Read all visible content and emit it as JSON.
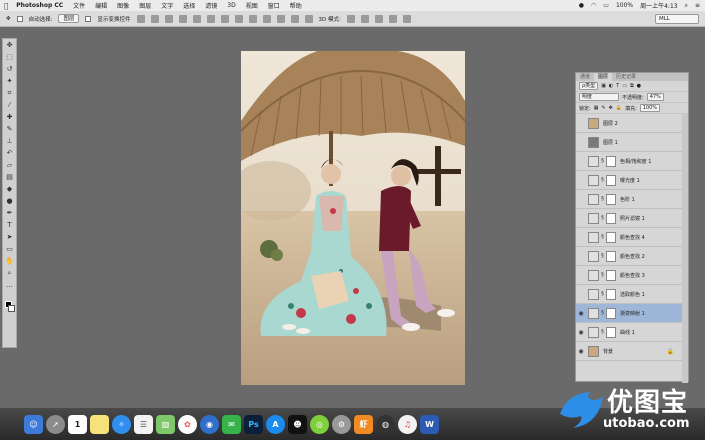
{
  "menubar": {
    "app_name": "Photoshop CC",
    "items": [
      "文件",
      "编辑",
      "图像",
      "图层",
      "文字",
      "选择",
      "滤镜",
      "3D",
      "视图",
      "窗口",
      "帮助"
    ],
    "battery": "100%",
    "clock": "周一上午4:13"
  },
  "options_bar": {
    "auto_select_label": "自动选择:",
    "auto_select_value": "图层",
    "show_transform_label": "显示变换控件",
    "mode_3d_label": "3D 模式:",
    "preset_value": "MLL"
  },
  "layers_panel": {
    "tabs": [
      "通道",
      "图层",
      "历史记录"
    ],
    "active_tab": "图层",
    "filter_label": "ρ类型",
    "blend_mode": "明度",
    "opacity_label": "不透明度:",
    "opacity_value": "47%",
    "lock_label": "锁定:",
    "fill_label": "填充:",
    "fill_value": "100%",
    "layers": [
      {
        "name": "图层 2",
        "visible": false,
        "has_mask": false
      },
      {
        "name": "图层 1",
        "visible": false,
        "has_mask": false
      },
      {
        "name": "色相/饱和度 1",
        "visible": false,
        "has_mask": true
      },
      {
        "name": "曝光度 1",
        "visible": false,
        "has_mask": true
      },
      {
        "name": "色阶 1",
        "visible": false,
        "has_mask": true
      },
      {
        "name": "照片滤镜 1",
        "visible": false,
        "has_mask": true
      },
      {
        "name": "颜色查找 4",
        "visible": false,
        "has_mask": true
      },
      {
        "name": "颜色查找 2",
        "visible": false,
        "has_mask": true
      },
      {
        "name": "颜色查找 3",
        "visible": false,
        "has_mask": true
      },
      {
        "name": "选取颜色 1",
        "visible": false,
        "has_mask": true
      },
      {
        "name": "渐变映射 1",
        "visible": true,
        "has_mask": true,
        "selected": true
      },
      {
        "name": "曲线 1",
        "visible": true,
        "has_mask": true
      },
      {
        "name": "背景",
        "visible": true,
        "has_mask": false,
        "locked": true
      }
    ]
  },
  "watermark": {
    "brand": "优图宝",
    "url": "utobao.com"
  },
  "dock": {
    "calendar_day": "1"
  }
}
